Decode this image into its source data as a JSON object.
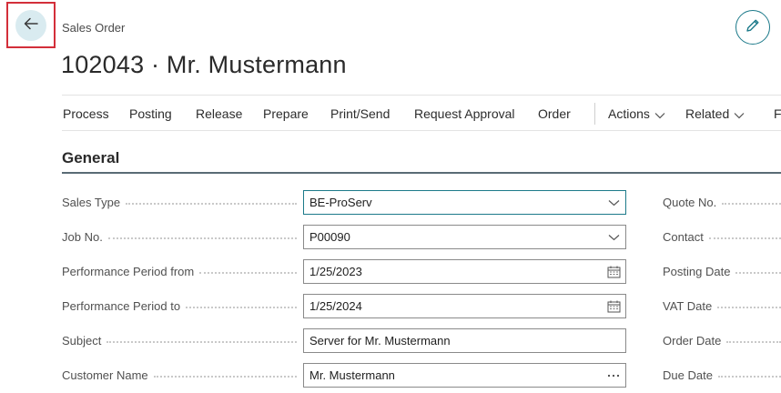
{
  "header": {
    "caption": "Sales Order",
    "title": "102043 · Mr. Mustermann",
    "back_icon": "arrow-left-icon",
    "edit_icon": "pencil-icon"
  },
  "actionbar": {
    "items": [
      "Process",
      "Posting",
      "Release",
      "Prepare",
      "Print/Send",
      "Request Approval",
      "Order",
      "Actions",
      "Related",
      "F"
    ]
  },
  "general": {
    "title": "General",
    "fields": [
      {
        "label": "Sales Type",
        "value": "BE-ProServ",
        "control": "dropdown"
      },
      {
        "label": "Job No.",
        "value": "P00090",
        "control": "dropdown"
      },
      {
        "label": "Performance Period from",
        "value": "1/25/2023",
        "control": "date"
      },
      {
        "label": "Performance Period to",
        "value": "1/25/2024",
        "control": "date"
      },
      {
        "label": "Subject",
        "value": "Server for Mr. Mustermann",
        "control": "text"
      },
      {
        "label": "Customer Name",
        "value": "Mr. Mustermann",
        "control": "lookup"
      }
    ],
    "right_labels": [
      "Quote No.",
      "Contact",
      "Posting Date",
      "VAT Date",
      "Order Date",
      "Due Date"
    ]
  },
  "colors": {
    "accent": "#1c7a8a",
    "highlight": "#d32f3a",
    "back_bg": "#d9ebf0"
  }
}
